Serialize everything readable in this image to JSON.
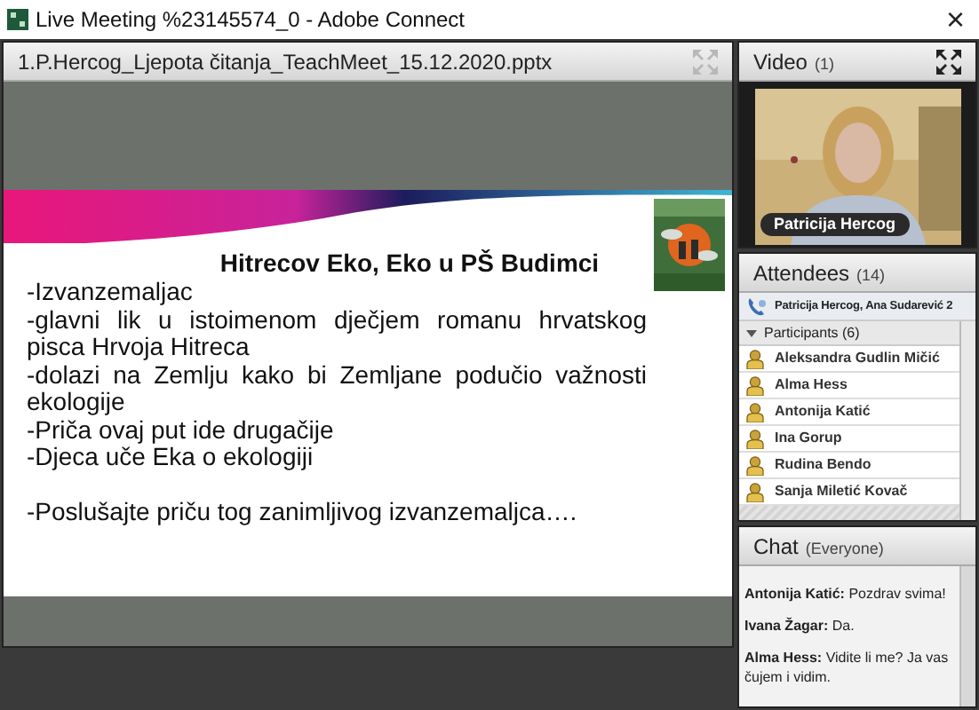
{
  "window": {
    "title": "Live Meeting %23145574_0 - Adobe Connect",
    "close": "×"
  },
  "share_pod": {
    "title": "1.P.Hercog_Ljepota čitanja_TeachMeet_15.12.2020.pptx",
    "slide": {
      "heading": "Hitrecov Eko, Eko u PŠ Budimci",
      "lines": [
        "-Izvanzemaljac",
        "-glavni lik u istoimenom dječjem romanu hrvatskog pisca Hrvoja Hitreca",
        "-dolazi na Zemlju kako bi Zemljane podučio važnosti ekologije",
        "-Priča ovaj put ide drugačije",
        "-Djeca uče Eka o ekologiji"
      ],
      "closing": "-Poslušajte priču tog zanimljivog izvanzemaljca…."
    }
  },
  "video_pod": {
    "title": "Video",
    "count": "(1)",
    "feed": {
      "name": "Patricija Hercog"
    }
  },
  "attendees_pod": {
    "title": "Attendees",
    "count": "(14)",
    "hosts": "Patricija Hercog, Ana Sudarević 2",
    "group": {
      "title": "Participants (6)",
      "expanded": true
    },
    "participants": [
      "Aleksandra Gudlin Mičić",
      "Alma Hess",
      "Antonija Katić",
      "Ina Gorup",
      "Rudina Bendo",
      "Sanja Miletić Kovač"
    ]
  },
  "chat_pod": {
    "title": "Chat",
    "scope": "(Everyone)",
    "messages": [
      {
        "author": "Antonija Katić:",
        "text": "Pozdrav svima!"
      },
      {
        "author": "Ivana Žagar:",
        "text": "Da."
      },
      {
        "author": "Alma Hess:",
        "text": "Vidite li me? Ja vas čujem i vidim."
      }
    ]
  }
}
